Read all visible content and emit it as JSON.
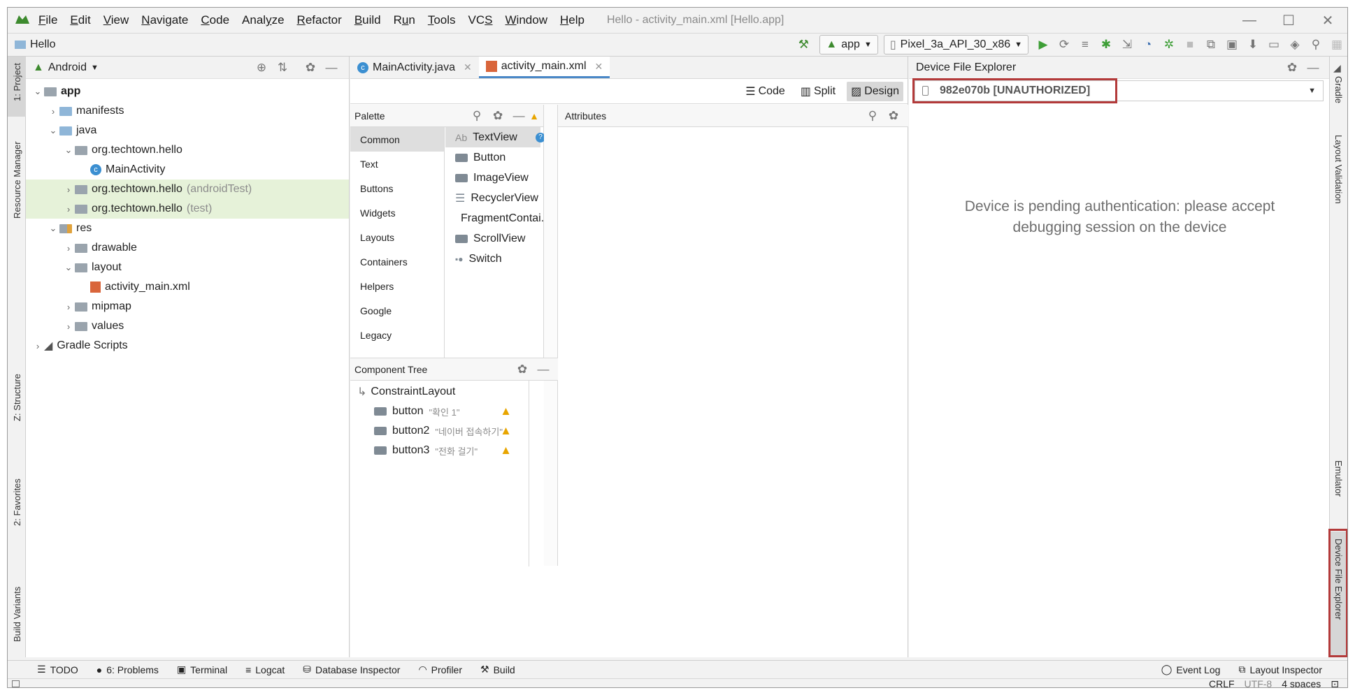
{
  "menu": {
    "items": [
      "File",
      "Edit",
      "View",
      "Navigate",
      "Code",
      "Analyze",
      "Refactor",
      "Build",
      "Run",
      "Tools",
      "VCS",
      "Window",
      "Help"
    ],
    "mnemonics": [
      "F",
      "E",
      "V",
      "N",
      "C",
      "y",
      "R",
      "B",
      "u",
      "T",
      "S",
      "W",
      "H"
    ],
    "window_title": "Hello - activity_main.xml [Hello.app]"
  },
  "navbar": {
    "project": "Hello",
    "run_config": "app",
    "device": "Pixel_3a_API_30_x86"
  },
  "left_strip": {
    "project_tab": "1: Project",
    "resource_manager": "Resource Manager",
    "structure": "Z: Structure",
    "favorites": "2: Favorites",
    "build_variants": "Build Variants"
  },
  "right_strip": {
    "gradle": "Gradle",
    "layout_validation": "Layout Validation",
    "emulator": "Emulator",
    "device_file_explorer": "Device File Explorer"
  },
  "project_panel": {
    "view_mode": "Android",
    "tree": [
      {
        "label": "app",
        "depth": 0,
        "arrow": "v",
        "icon": "module-folder-icon",
        "bold": true
      },
      {
        "label": "manifests",
        "depth": 1,
        "arrow": ">",
        "icon": "folder-icon"
      },
      {
        "label": "java",
        "depth": 1,
        "arrow": "v",
        "icon": "folder-icon"
      },
      {
        "label": "org.techtown.hello",
        "depth": 2,
        "arrow": "v",
        "icon": "package-icon"
      },
      {
        "label": "MainActivity",
        "depth": 3,
        "arrow": "",
        "icon": "class-icon"
      },
      {
        "label": "org.techtown.hello",
        "suffix": "(androidTest)",
        "depth": 2,
        "arrow": ">",
        "icon": "package-icon",
        "highlight": true
      },
      {
        "label": "org.techtown.hello",
        "suffix": "(test)",
        "depth": 2,
        "arrow": ">",
        "icon": "package-icon",
        "highlight": true
      },
      {
        "label": "res",
        "depth": 1,
        "arrow": "v",
        "icon": "res-folder-icon"
      },
      {
        "label": "drawable",
        "depth": 2,
        "arrow": ">",
        "icon": "package-icon"
      },
      {
        "label": "layout",
        "depth": 2,
        "arrow": "v",
        "icon": "package-icon"
      },
      {
        "label": "activity_main.xml",
        "depth": 3,
        "arrow": "",
        "icon": "xml-file-icon"
      },
      {
        "label": "mipmap",
        "depth": 2,
        "arrow": ">",
        "icon": "package-icon"
      },
      {
        "label": "values",
        "depth": 2,
        "arrow": ">",
        "icon": "package-icon"
      },
      {
        "label": "Gradle Scripts",
        "depth": 0,
        "arrow": ">",
        "icon": "gradle-icon"
      }
    ]
  },
  "editor": {
    "tabs": [
      {
        "label": "MainActivity.java",
        "active": false
      },
      {
        "label": "activity_main.xml",
        "active": true
      }
    ],
    "modes": [
      "Code",
      "Split",
      "Design"
    ],
    "palette_title": "Palette",
    "attributes_title": "Attributes",
    "categories": [
      "Common",
      "Text",
      "Buttons",
      "Widgets",
      "Layouts",
      "Containers",
      "Helpers",
      "Google",
      "Legacy"
    ],
    "widgets": [
      "TextView",
      "Button",
      "ImageView",
      "RecyclerView",
      "FragmentContai...",
      "ScrollView",
      "Switch"
    ],
    "textview_prefix": "Ab",
    "component_tree_title": "Component Tree",
    "component_root": "ConstraintLayout",
    "components": [
      {
        "name": "button",
        "text": "\"확인 1\""
      },
      {
        "name": "button2",
        "text": "\"네이버 접속하기\""
      },
      {
        "name": "button3",
        "text": "\"전화 걸기\""
      }
    ]
  },
  "device_explorer": {
    "title": "Device File Explorer",
    "device": "982e070b [UNAUTHORIZED]",
    "message_line1": "Device is pending authentication: please accept",
    "message_line2": "debugging session on the device"
  },
  "tool_windows": {
    "todo": "TODO",
    "problems": "6: Problems",
    "terminal": "Terminal",
    "logcat": "Logcat",
    "database_inspector": "Database Inspector",
    "profiler": "Profiler",
    "build": "Build",
    "event_log": "Event Log",
    "layout_inspector": "Layout Inspector"
  },
  "status_bar": {
    "line_sep": "CRLF",
    "encoding": "UTF-8",
    "indent": "4 spaces"
  },
  "colors": {
    "accent_green": "#3d8a2e",
    "highlight_red": "#b33a3a",
    "tree_highlight": "#e6f2d9"
  }
}
